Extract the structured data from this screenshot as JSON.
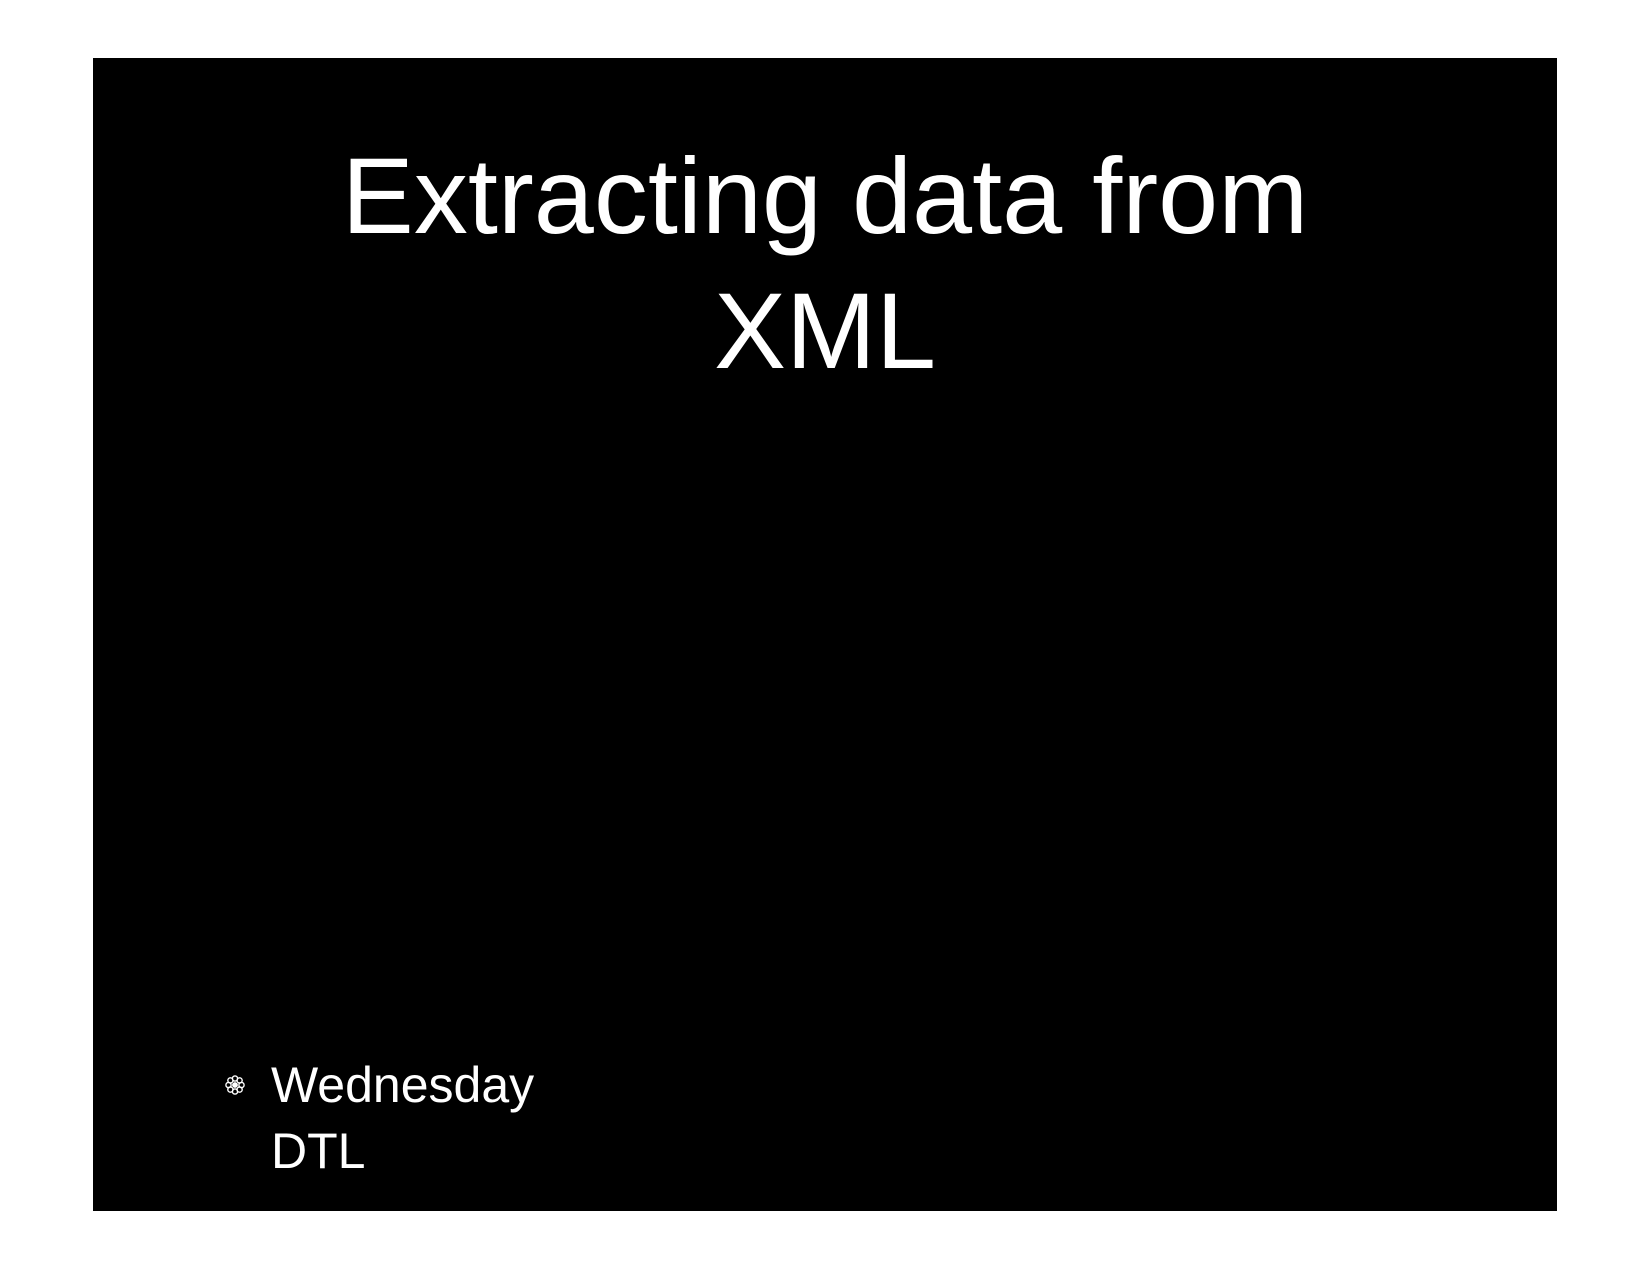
{
  "slide": {
    "title": "Extracting data from\nXML",
    "bullets": [
      {
        "label": "Wednesday",
        "sub": "DTL"
      }
    ],
    "bullet_icon": "flower-icon"
  }
}
